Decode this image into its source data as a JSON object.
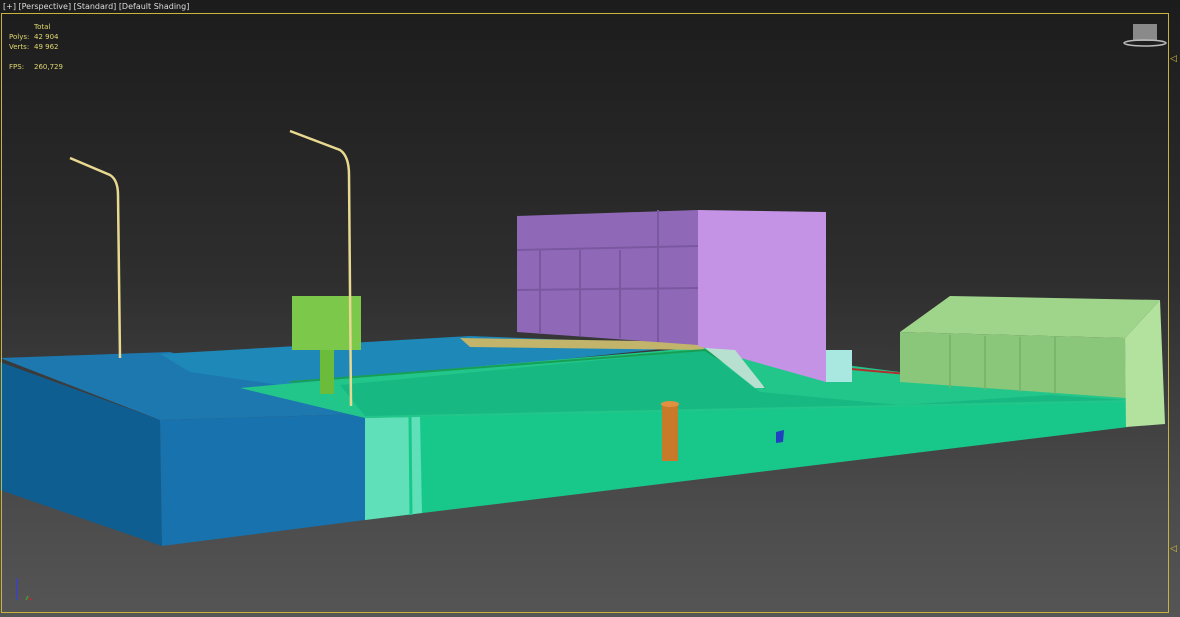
{
  "viewport": {
    "menu": "[+]",
    "view": "[Perspective]",
    "mode": "[Standard]",
    "shading": "[Default Shading]"
  },
  "stats": {
    "header": "Total",
    "polys_label": "Polys:",
    "polys": "42 904",
    "verts_label": "Verts:",
    "verts": "49 962",
    "fps_label": "FPS:",
    "fps": "260,729"
  },
  "colors": {
    "border": "#c8b43c",
    "blue_block": "#1a6fa6",
    "terrain": "#17c98a",
    "building": "#a870d0",
    "shed": "#9fd58a"
  }
}
